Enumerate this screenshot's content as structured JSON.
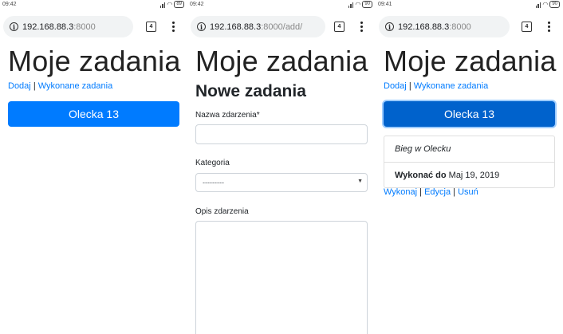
{
  "screens": [
    {
      "status": {
        "time": "09:42",
        "battery": "89"
      },
      "browser": {
        "url_host": "192.168.88.3",
        "url_rest": ":8000",
        "tab_count": "4"
      },
      "page": {
        "title": "Moje zadania",
        "nav": {
          "add": "Dodaj",
          "separator": "|",
          "done": "Wykonane zadania"
        },
        "task_button": "Olecka 13"
      }
    },
    {
      "status": {
        "time": "09:42",
        "battery": "90"
      },
      "browser": {
        "url_host": "192.168.88.3",
        "url_rest": ":8000/add/",
        "tab_count": "4"
      },
      "page": {
        "title": "Moje zadania",
        "heading": "Nowe zadania",
        "form": {
          "name_label": "Nazwa zdarzenia*",
          "name_value": "",
          "category_label": "Kategoria",
          "category_selected": "---------",
          "description_label": "Opis zdarzenia",
          "description_value": ""
        }
      }
    },
    {
      "status": {
        "time": "09:41",
        "battery": "90"
      },
      "browser": {
        "url_host": "192.168.88.3",
        "url_rest": ":8000",
        "tab_count": "4"
      },
      "page": {
        "title": "Moje zadania",
        "nav": {
          "add": "Dodaj",
          "separator": "|",
          "done": "Wykonane zadania"
        },
        "task_button": "Olecka 13",
        "task_detail": {
          "description": "Bieg w Olecku",
          "due_label": "Wykonać do",
          "due_value": "Maj 19, 2019"
        },
        "actions": {
          "complete": "Wykonaj",
          "sep1": "|",
          "edit": "Edycja",
          "sep2": "|",
          "delete": "Usuń"
        }
      }
    }
  ],
  "colors": {
    "primary": "#007bff",
    "primary_active": "#0062cc",
    "border": "#ced4da"
  },
  "icons": [
    "info-icon",
    "tab-switcher-icon",
    "overflow-menu-icon",
    "signal-icon",
    "wifi-icon",
    "battery-icon",
    "dropdown-caret-icon"
  ]
}
